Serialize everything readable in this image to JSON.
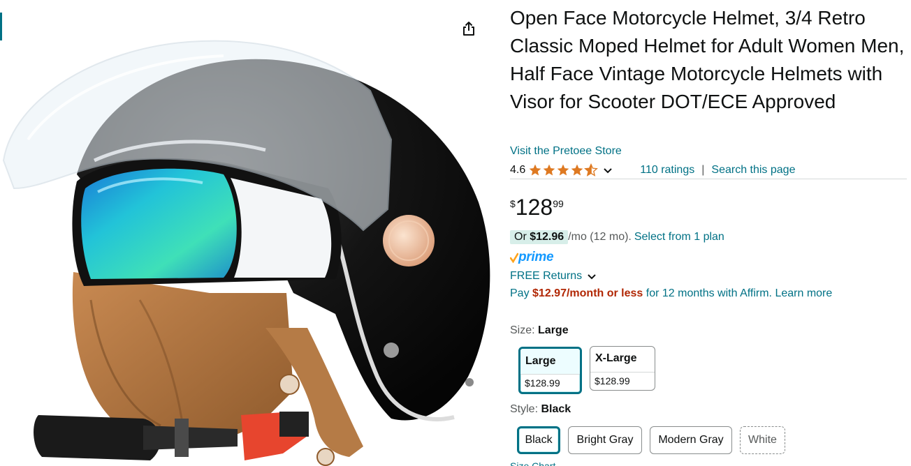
{
  "product": {
    "title": "Open Face Motorcycle Helmet, 3/4 Retro Classic Moped Helmet for Adult Women Men, Half Face Vintage Motorcycle Helmets with Visor for Scooter DOT/ECE Approved",
    "store_link": "Visit the Pretoee Store",
    "rating": "4.6",
    "rating_stars": 4.6,
    "ratings_count": "110 ratings",
    "rating_separator": "|",
    "search_link": "Search this page"
  },
  "price": {
    "symbol": "$",
    "whole": "128",
    "fraction": "99"
  },
  "monthly": {
    "prefix": "Or",
    "amount": "$12.96",
    "suffix": "/mo (12 mo).",
    "plan_link": "Select from 1 plan"
  },
  "prime": {
    "label": "prime",
    "check_color": "#ffa41c",
    "brand_color": "#1399ff"
  },
  "returns": {
    "label": "FREE Returns"
  },
  "affirm": {
    "prefix": "Pay",
    "amount": "$12.97/month or less",
    "middle": "for 12 months with Affirm.",
    "learn_more": "Learn more"
  },
  "size": {
    "label": "Size:",
    "selected": "Large",
    "options": [
      {
        "name": "Large",
        "price": "$128.99",
        "selected": true
      },
      {
        "name": "X-Large",
        "price": "$128.99",
        "selected": false
      }
    ]
  },
  "style": {
    "label": "Style:",
    "selected": "Black",
    "options": [
      {
        "name": "Black",
        "selected": true,
        "available": true
      },
      {
        "name": "Bright Gray",
        "selected": false,
        "available": true
      },
      {
        "name": "Modern Gray",
        "selected": false,
        "available": true
      },
      {
        "name": "White",
        "selected": false,
        "available": false
      }
    ]
  },
  "size_chart": "Size Chart",
  "icons": {
    "share": "share-icon",
    "chevron": "chevron-down-icon",
    "star": "star-icon"
  },
  "colors": {
    "link": "#007185",
    "price_accent": "#b12704",
    "star": "#de7921",
    "selected_border": "#007185"
  }
}
